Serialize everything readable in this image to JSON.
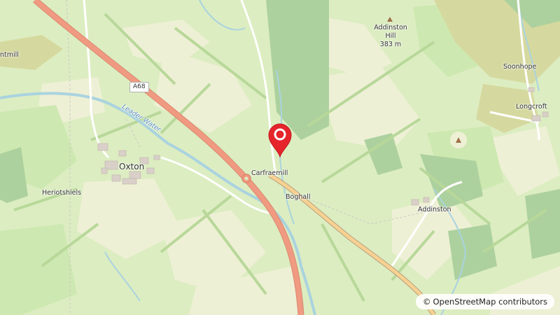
{
  "map": {
    "places": {
      "oxton": "Oxton",
      "heriotshiels": "Heriotshiels",
      "carfraemill": "Carfraemill",
      "boghall": "Boghall",
      "addinston": "Addinston",
      "soonhope": "Soonhope",
      "longcroft": "Longcroft",
      "ntmill": "ntmill"
    },
    "peak": {
      "name_line1": "Addinston",
      "name_line2": "Hill",
      "elevation": "383 m"
    },
    "road": {
      "ref": "A68"
    },
    "water": {
      "name": "Leader Water"
    },
    "attribution": "OpenStreetMap contributors",
    "attribution_symbol": "©",
    "colors": {
      "farmland": "#dcedc1",
      "field": "#eef0d5",
      "grass": "#cde8b0",
      "forest": "#add19e",
      "heath": "#d6d99f",
      "river": "#aad3df",
      "trunk_road": "#f09a81",
      "secondary_road": "#f7d191",
      "marker": "#e5242b"
    },
    "marker_icon": "map-pin-icon"
  }
}
